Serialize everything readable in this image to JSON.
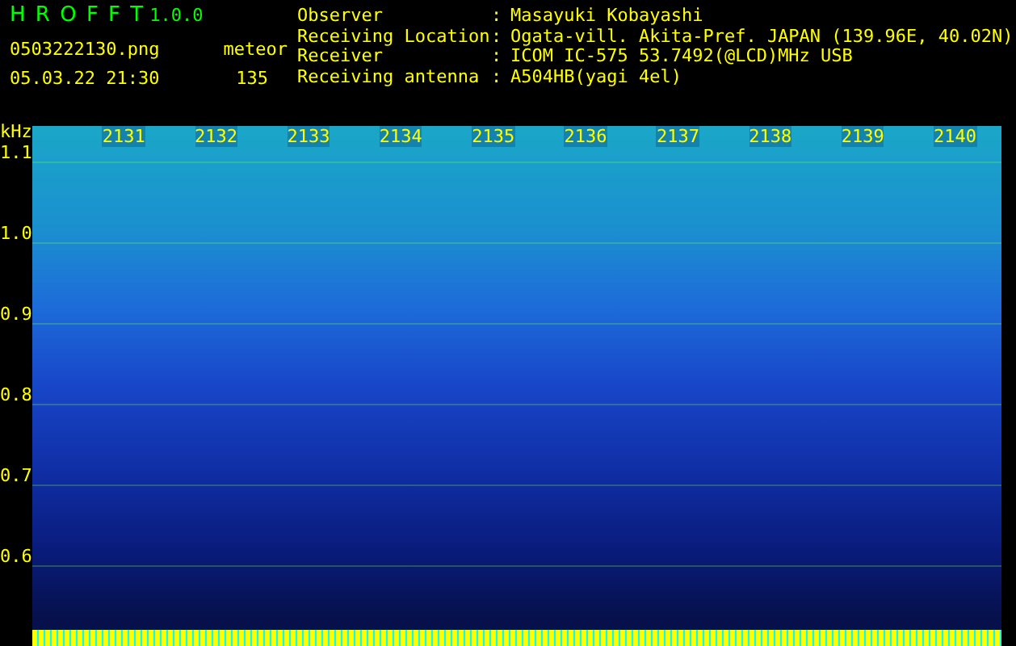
{
  "header": {
    "app_title": "H R O F F T",
    "version": "1.0.0",
    "filename": "0503222130.png",
    "mode": "meteor",
    "datetime": "05.03.22 21:30",
    "count": "135"
  },
  "info": [
    {
      "label": "Observer",
      "colon": ":",
      "value": "Masayuki Kobayashi"
    },
    {
      "label": "Receiving Location",
      "colon": ":",
      "value": "Ogata-vill. Akita-Pref. JAPAN (139.96E, 40.02N)"
    },
    {
      "label": "Receiver",
      "colon": ":",
      "value": "ICOM IC-575 53.7492(@LCD)MHz USB"
    },
    {
      "label": "Receiving antenna",
      "colon": ":",
      "value": "A504HB(yagi 4el)"
    }
  ],
  "spectrogram": {
    "unit": "kHz",
    "y_labels": [
      "1.1",
      "1.0",
      "0.9",
      "0.8",
      "0.7",
      "0.6"
    ],
    "time_labels": [
      "2131",
      "2132",
      "2133",
      "2134",
      "2135",
      "2136",
      "2137",
      "2138",
      "2139",
      "2140"
    ]
  }
}
